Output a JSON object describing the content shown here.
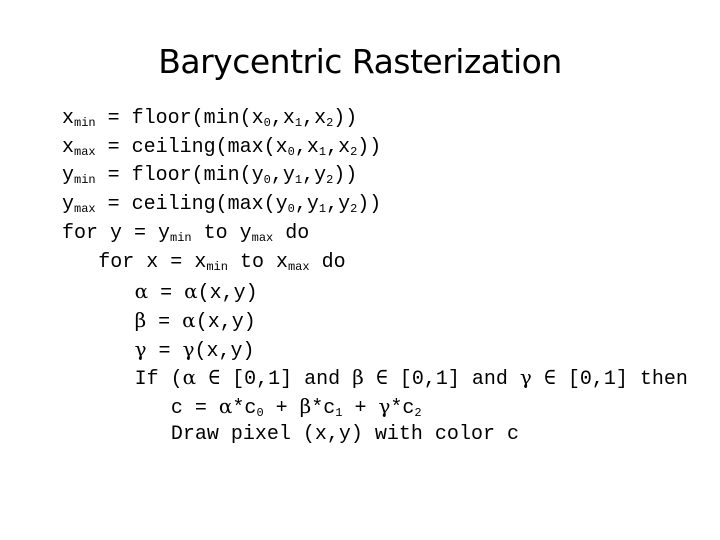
{
  "slide": {
    "title": "Barycentric Rasterization",
    "code_lines": [
      {
        "indent": 0,
        "segments": [
          {
            "t": "x"
          },
          {
            "sub": "min"
          },
          {
            "t": " = floor(min(x"
          },
          {
            "sub": "0"
          },
          {
            "t": ",x"
          },
          {
            "sub": "1"
          },
          {
            "t": ",x"
          },
          {
            "sub": "2"
          },
          {
            "t": "))"
          }
        ]
      },
      {
        "indent": 0,
        "segments": [
          {
            "t": "x"
          },
          {
            "sub": "max"
          },
          {
            "t": " = ceiling(max(x"
          },
          {
            "sub": "0"
          },
          {
            "t": ",x"
          },
          {
            "sub": "1"
          },
          {
            "t": ",x"
          },
          {
            "sub": "2"
          },
          {
            "t": "))"
          }
        ]
      },
      {
        "indent": 0,
        "segments": [
          {
            "t": "y"
          },
          {
            "sub": "min"
          },
          {
            "t": " = floor(min(y"
          },
          {
            "sub": "0"
          },
          {
            "t": ",y"
          },
          {
            "sub": "1"
          },
          {
            "t": ",y"
          },
          {
            "sub": "2"
          },
          {
            "t": "))"
          }
        ]
      },
      {
        "indent": 0,
        "segments": [
          {
            "t": "y"
          },
          {
            "sub": "max"
          },
          {
            "t": " = ceiling(max(y"
          },
          {
            "sub": "0"
          },
          {
            "t": ",y"
          },
          {
            "sub": "1"
          },
          {
            "t": ",y"
          },
          {
            "sub": "2"
          },
          {
            "t": "))"
          }
        ]
      },
      {
        "indent": 0,
        "segments": [
          {
            "t": "for y = y"
          },
          {
            "sub": "min"
          },
          {
            "t": " to y"
          },
          {
            "sub": "max"
          },
          {
            "t": " do"
          }
        ]
      },
      {
        "indent": 1,
        "segments": [
          {
            "t": "for x = x"
          },
          {
            "sub": "min"
          },
          {
            "t": " to x"
          },
          {
            "sub": "max"
          },
          {
            "t": " do"
          }
        ]
      },
      {
        "indent": 2,
        "segments": [
          {
            "g": "α"
          },
          {
            "t": " = "
          },
          {
            "g": "α"
          },
          {
            "t": "(x,y)"
          }
        ]
      },
      {
        "indent": 2,
        "segments": [
          {
            "g": "β"
          },
          {
            "t": " = "
          },
          {
            "g": "α"
          },
          {
            "t": "(x,y)"
          }
        ]
      },
      {
        "indent": 2,
        "segments": [
          {
            "g": "γ"
          },
          {
            "t": " = "
          },
          {
            "g": "γ"
          },
          {
            "t": "(x,y)"
          }
        ]
      },
      {
        "indent": 2,
        "segments": [
          {
            "t": "If ("
          },
          {
            "g": "α"
          },
          {
            "t": " ∈ [0,1] and "
          },
          {
            "g": "β"
          },
          {
            "t": " ∈ [0,1] and "
          },
          {
            "g": "γ"
          },
          {
            "t": " ∈ [0,1] then"
          }
        ]
      },
      {
        "indent": 3,
        "segments": [
          {
            "t": "c = "
          },
          {
            "g": "α"
          },
          {
            "t": "*c"
          },
          {
            "sub": "0"
          },
          {
            "t": " + "
          },
          {
            "g": "β"
          },
          {
            "t": "*c"
          },
          {
            "sub": "1"
          },
          {
            "t": " + "
          },
          {
            "g": "γ"
          },
          {
            "t": "*c"
          },
          {
            "sub": "2"
          }
        ]
      },
      {
        "indent": 3,
        "segments": [
          {
            "t": "Draw pixel (x,y) with color c"
          }
        ]
      }
    ]
  }
}
